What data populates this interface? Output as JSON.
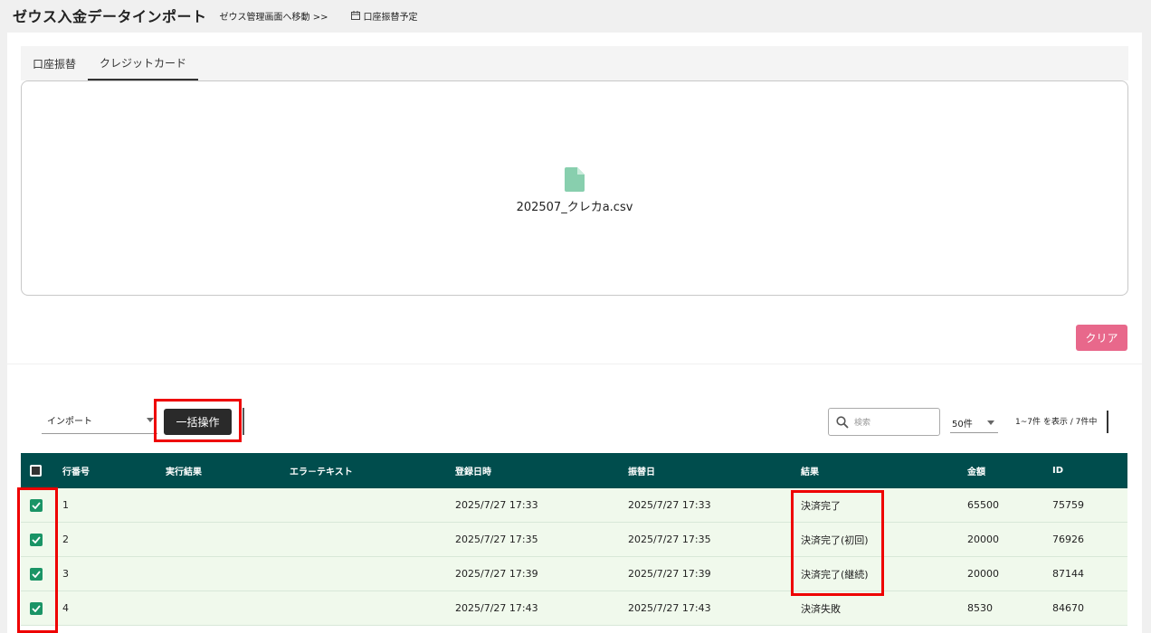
{
  "header": {
    "title": "ゼウス入金データインポート",
    "manage_link": "ゼウス管理画面へ移動 >>",
    "schedule_link": "口座振替予定"
  },
  "tabs": [
    {
      "label": "口座振替",
      "active": false
    },
    {
      "label": "クレジットカード",
      "active": true
    }
  ],
  "upload": {
    "file_name": "202507_クレカa.csv",
    "file_icon_color": "#88cfae"
  },
  "actions": {
    "clear_label": "クリア",
    "clear_color": "#e8688b"
  },
  "toolbar": {
    "operation_select": "インポート",
    "bulk_label": "一括操作",
    "search_placeholder": "検索",
    "per_page": "50件",
    "page_info": "1~7件 を表示 / 7件中"
  },
  "table": {
    "header_color": "#004d4d",
    "columns": {
      "row_no": "行番号",
      "exec_result": "実行結果",
      "error_text": "エラ－テキスト",
      "registered_at": "登録日時",
      "transfer_date": "振替日",
      "result": "結果",
      "amount": "金額",
      "id": "ID"
    },
    "rows": [
      {
        "checked": true,
        "row_no": "1",
        "exec_result": "",
        "error_text": "",
        "registered_at": "2025/7/27 17:33",
        "transfer_date": "2025/7/27 17:33",
        "result": "決済完了",
        "amount": "65500",
        "id": "75759"
      },
      {
        "checked": true,
        "row_no": "2",
        "exec_result": "",
        "error_text": "",
        "registered_at": "2025/7/27 17:35",
        "transfer_date": "2025/7/27 17:35",
        "result": "決済完了(初回)",
        "amount": "20000",
        "id": "76926"
      },
      {
        "checked": true,
        "row_no": "3",
        "exec_result": "",
        "error_text": "",
        "registered_at": "2025/7/27 17:39",
        "transfer_date": "2025/7/27 17:39",
        "result": "決済完了(継続)",
        "amount": "20000",
        "id": "87144"
      },
      {
        "checked": true,
        "row_no": "4",
        "exec_result": "",
        "error_text": "",
        "registered_at": "2025/7/27 17:43",
        "transfer_date": "2025/7/27 17:43",
        "result": "決済失敗",
        "amount": "8530",
        "id": "84670"
      }
    ]
  }
}
